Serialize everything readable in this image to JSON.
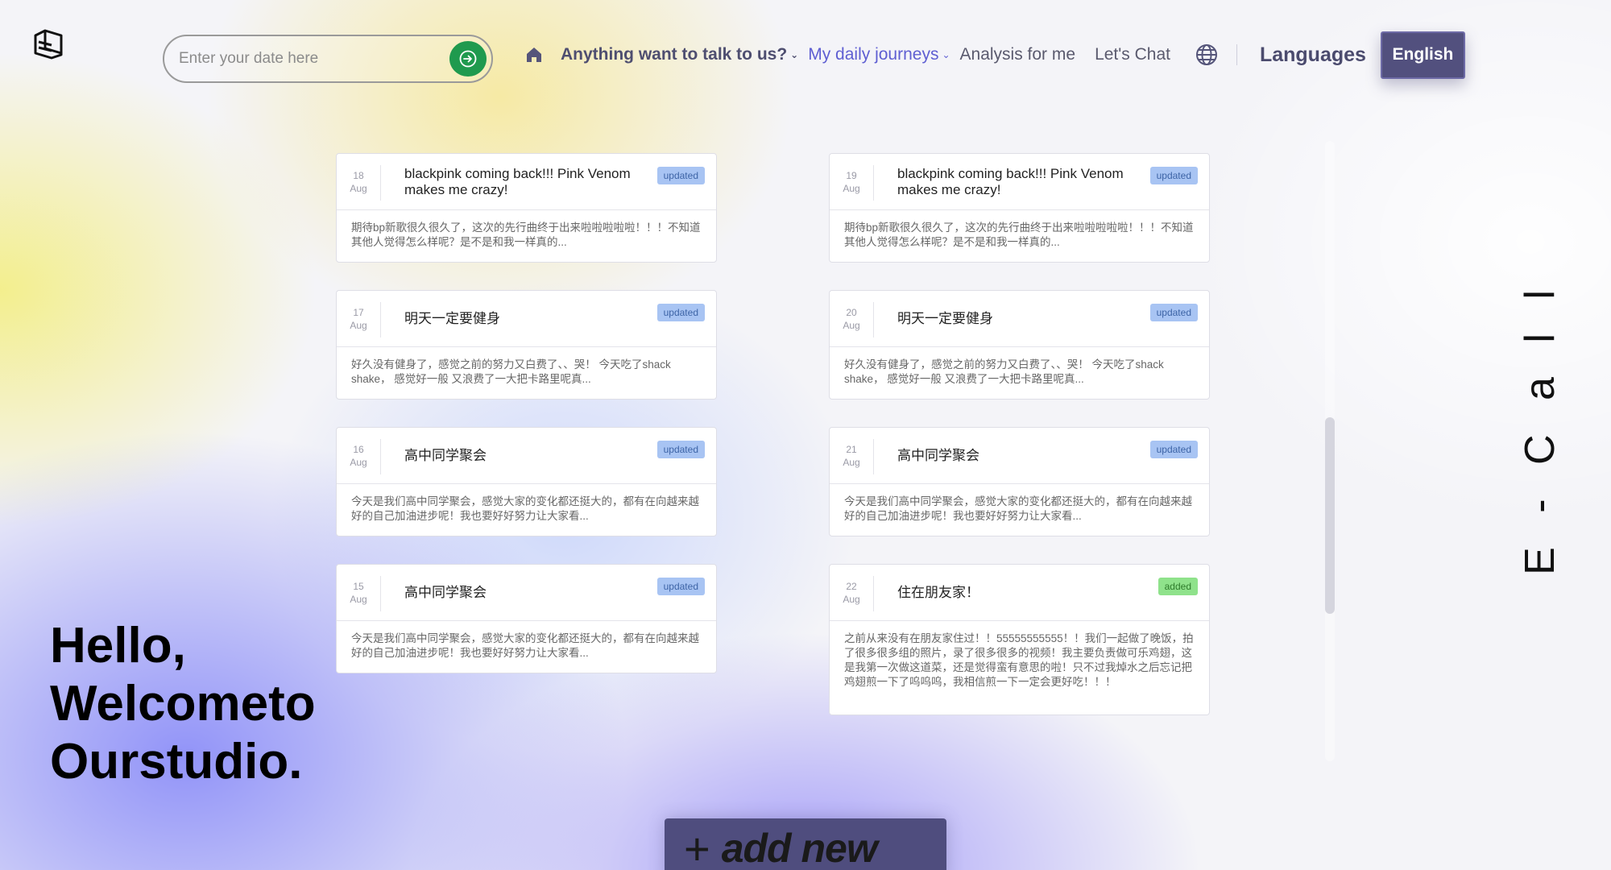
{
  "search": {
    "placeholder": "Enter your date here"
  },
  "nav": {
    "talk_label": "Anything want to talk to us?",
    "journeys_label": "My daily journeys",
    "analysis_label": "Analysis for me",
    "chat_label": "Let's Chat",
    "languages_label": "Languages",
    "language_button": "English"
  },
  "hero": {
    "line1": "Hello,",
    "line2": "Welcometo",
    "line3": "Ourstudio."
  },
  "side_text": "E - C a l l",
  "add_new": {
    "label": "add new"
  },
  "colors": {
    "accent": "#52507e",
    "active_link": "#5f5fd2",
    "go_button": "#1f9a4e",
    "updated_badge": "#a8c4f3",
    "added_badge": "#8fe28b"
  },
  "entries": [
    {
      "day": "18",
      "month": "Aug",
      "title": "blackpink coming back!!! Pink Venom makes me crazy!",
      "badge": "updated",
      "body": "期待bp新歌很久很久了，这次的先行曲终于出来啦啦啦啦啦！！！不知道其他人觉得怎么样呢？是不是和我一样真的..."
    },
    {
      "day": "19",
      "month": "Aug",
      "title": "blackpink coming back!!! Pink Venom makes me crazy!",
      "badge": "updated",
      "body": "期待bp新歌很久很久了，这次的先行曲终于出来啦啦啦啦啦！！！不知道其他人觉得怎么样呢？是不是和我一样真的..."
    },
    {
      "day": "17",
      "month": "Aug",
      "title": "明天一定要健身",
      "badge": "updated",
      "body": "好久没有健身了，感觉之前的努力又白费了、、哭！ 今天吃了shack shake， 感觉好一般 又浪费了一大把卡路里呢真..."
    },
    {
      "day": "20",
      "month": "Aug",
      "title": "明天一定要健身",
      "badge": "updated",
      "body": "好久没有健身了，感觉之前的努力又白费了、、哭！ 今天吃了shack shake， 感觉好一般 又浪费了一大把卡路里呢真..."
    },
    {
      "day": "16",
      "month": "Aug",
      "title": "高中同学聚会",
      "badge": "updated",
      "body": "今天是我们高中同学聚会，感觉大家的变化都还挺大的，都有在向越来越好的自己加油进步呢！我也要好好努力让大家看..."
    },
    {
      "day": "21",
      "month": "Aug",
      "title": "高中同学聚会",
      "badge": "updated",
      "body": "今天是我们高中同学聚会，感觉大家的变化都还挺大的，都有在向越来越好的自己加油进步呢！我也要好好努力让大家看..."
    },
    {
      "day": "15",
      "month": "Aug",
      "title": "高中同学聚会",
      "badge": "updated",
      "body": "今天是我们高中同学聚会，感觉大家的变化都还挺大的，都有在向越来越好的自己加油进步呢！我也要好好努力让大家看..."
    },
    {
      "day": "22",
      "month": "Aug",
      "title": "住在朋友家！",
      "badge": "added",
      "body": "之前从来没有在朋友家住过！！55555555555！！我们一起做了晚饭，拍了很多很多组的照片，录了很多很多的视频！我主要负责做可乐鸡翅，这是我第一次做这道菜，还是觉得蛮有意思的啦！只不过我焯水之后忘记把鸡翅煎一下了呜呜呜，我相信煎一下一定会更好吃！！！"
    }
  ]
}
